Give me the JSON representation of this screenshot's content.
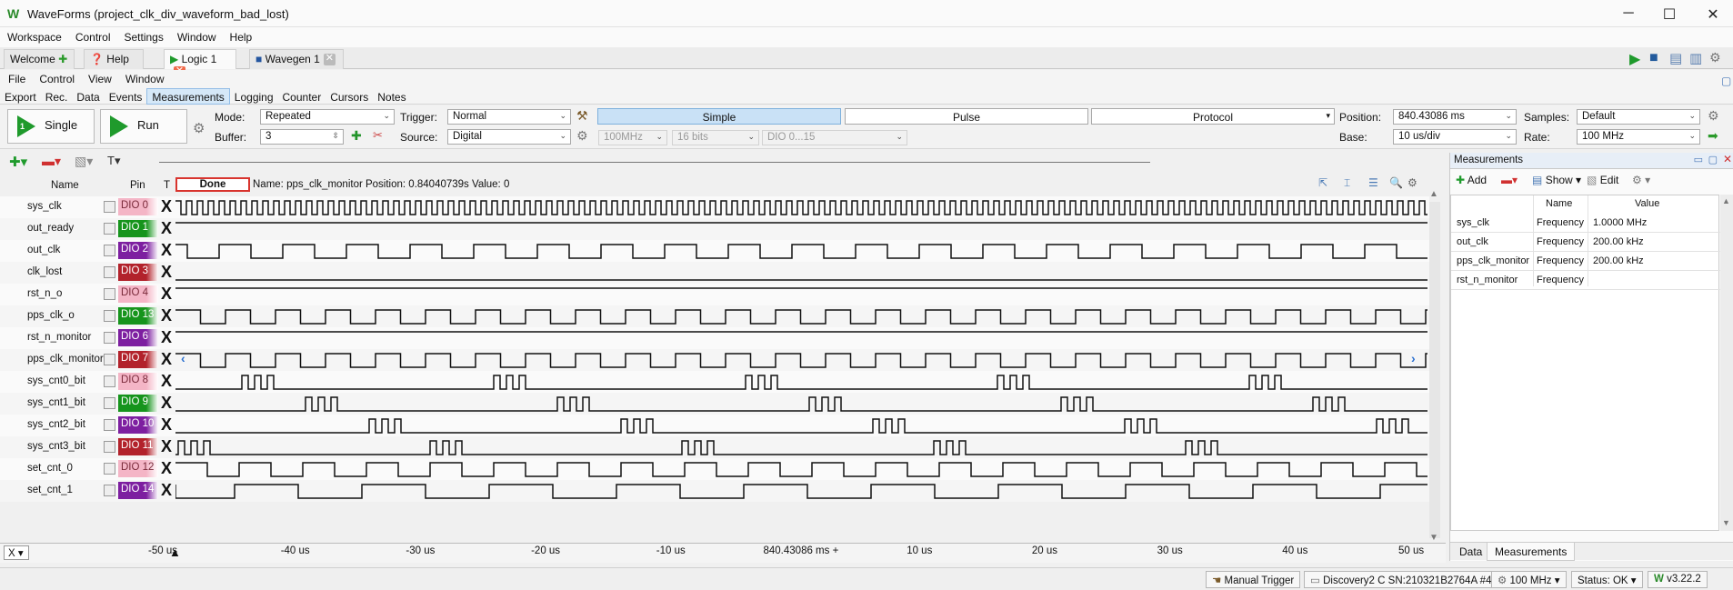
{
  "window": {
    "title": "WaveForms (project_clk_div_waveform_bad_lost)",
    "min": "─",
    "max": "☐",
    "close": "✕"
  },
  "menu": [
    "Workspace",
    "Control",
    "Settings",
    "Window",
    "Help"
  ],
  "tabs": [
    {
      "label": "Welcome"
    },
    {
      "label": "Help"
    },
    {
      "label": "Logic 1"
    },
    {
      "label": "Wavegen 1"
    }
  ],
  "submenu": [
    "File",
    "Control",
    "View",
    "Window"
  ],
  "subtabs": [
    "Export",
    "Rec.",
    "Data",
    "Events",
    "Measurements",
    "Logging",
    "Counter",
    "Cursors",
    "Notes"
  ],
  "toolbar": {
    "single": "Single",
    "run": "Run",
    "single_num": "1",
    "mode_label": "Mode:",
    "mode_value": "Repeated",
    "buffer_label": "Buffer:",
    "buffer_value": "3",
    "trigger_label": "Trigger:",
    "trigger_value": "Normal",
    "source_label": "Source:",
    "source_value": "Digital",
    "rate_value": "100MHz",
    "bits_value": "16 bits",
    "dio_value": "DIO 0...15",
    "seg_simple": "Simple",
    "seg_pulse": "Pulse",
    "seg_protocol": "Protocol",
    "position_label": "Position:",
    "position_value": "840.43086 ms",
    "base_label": "Base:",
    "base_value": "10 us/div",
    "samples_label": "Samples:",
    "samples_value": "Default",
    "rate_label": "Rate:",
    "rate2_value": "100 MHz"
  },
  "plot": {
    "status": "Done",
    "info": "Name: pps_clk_monitor  Position: 0.84040739s  Value: 0",
    "col_name": "Name",
    "col_pin": "Pin",
    "col_t": "T"
  },
  "signals": [
    {
      "name": "sys_clk",
      "pin": "DIO 0",
      "color": "#f4b5c6",
      "text": "#7a2b3b",
      "kind": "clk",
      "period": 12
    },
    {
      "name": "out_ready",
      "pin": "DIO 1",
      "color": "#16941c",
      "text": "#ffffff",
      "kind": "high"
    },
    {
      "name": "out_clk",
      "pin": "DIO 2",
      "color": "#7d1fa0",
      "text": "#ffffff",
      "kind": "clk",
      "period": 70,
      "offset": 22
    },
    {
      "name": "clk_lost",
      "pin": "DIO 3",
      "color": "#b2222b",
      "text": "#ffffff",
      "kind": "low"
    },
    {
      "name": "rst_n_o",
      "pin": "DIO 4",
      "color": "#f4b5c6",
      "text": "#7a2b3b",
      "kind": "high"
    },
    {
      "name": "pps_clk_o",
      "pin": "DIO 13",
      "color": "#16941c",
      "text": "#ffffff",
      "kind": "clk",
      "period": 55,
      "offset": 0
    },
    {
      "name": "rst_n_monitor",
      "pin": "DIO 6",
      "color": "#7d1fa0",
      "text": "#ffffff",
      "kind": "high"
    },
    {
      "name": "pps_clk_monitor",
      "pin": "DIO 7",
      "color": "#b2222b",
      "text": "#ffffff",
      "kind": "clk",
      "period": 55,
      "offset": 0
    },
    {
      "name": "sys_cnt0_bit",
      "pin": "DIO 8",
      "color": "#f4b5c6",
      "text": "#7a2b3b",
      "kind": "burst",
      "groupPeriod": 277,
      "offset": 73
    },
    {
      "name": "sys_cnt1_bit",
      "pin": "DIO 9",
      "color": "#16941c",
      "text": "#ffffff",
      "kind": "burst",
      "groupPeriod": 277,
      "offset": 143
    },
    {
      "name": "sys_cnt2_bit",
      "pin": "DIO 10",
      "color": "#7d1fa0",
      "text": "#ffffff",
      "kind": "burst",
      "groupPeriod": 277,
      "offset": 213
    },
    {
      "name": "sys_cnt3_bit",
      "pin": "DIO 11",
      "color": "#b2222b",
      "text": "#ffffff",
      "kind": "burst",
      "groupPeriod": 277,
      "offset": 3
    },
    {
      "name": "set_cnt_0",
      "pin": "DIO 12",
      "color": "#f4b5c6",
      "text": "#7a2b3b",
      "kind": "clk",
      "period": 70,
      "offset": 0
    },
    {
      "name": "set_cnt_1",
      "pin": "DIO 14",
      "color": "#7d1fa0",
      "text": "#ffffff",
      "kind": "clk",
      "period": 140,
      "offset": 75
    }
  ],
  "trigger_mark": "X",
  "axis": [
    "-50 us",
    "-40 us",
    "-30 us",
    "-20 us",
    "-10 us",
    "840.43086 ms +",
    "10 us",
    "20 us",
    "30 us",
    "40 us",
    "50 us"
  ],
  "axis_x_btn": "X",
  "measurements": {
    "title": "Measurements",
    "add": "Add",
    "show": "Show",
    "edit": "Edit",
    "col_name": "Name",
    "col_value": "Value",
    "rows": [
      {
        "signal": "sys_clk",
        "name": "Frequency",
        "value": "1.0000 MHz"
      },
      {
        "signal": "out_clk",
        "name": "Frequency",
        "value": "200.00 kHz"
      },
      {
        "signal": "pps_clk_monitor",
        "name": "Frequency",
        "value": "200.00 kHz"
      },
      {
        "signal": "rst_n_monitor",
        "name": "Frequency",
        "value": ""
      }
    ],
    "tab_data": "Data",
    "tab_meas": "Measurements"
  },
  "statusbar": {
    "manual": "Manual Trigger",
    "device": "Discovery2 C SN:210321B2764A #4",
    "clock": "100 MHz",
    "status": "Status: OK",
    "version": "v3.22.2"
  }
}
